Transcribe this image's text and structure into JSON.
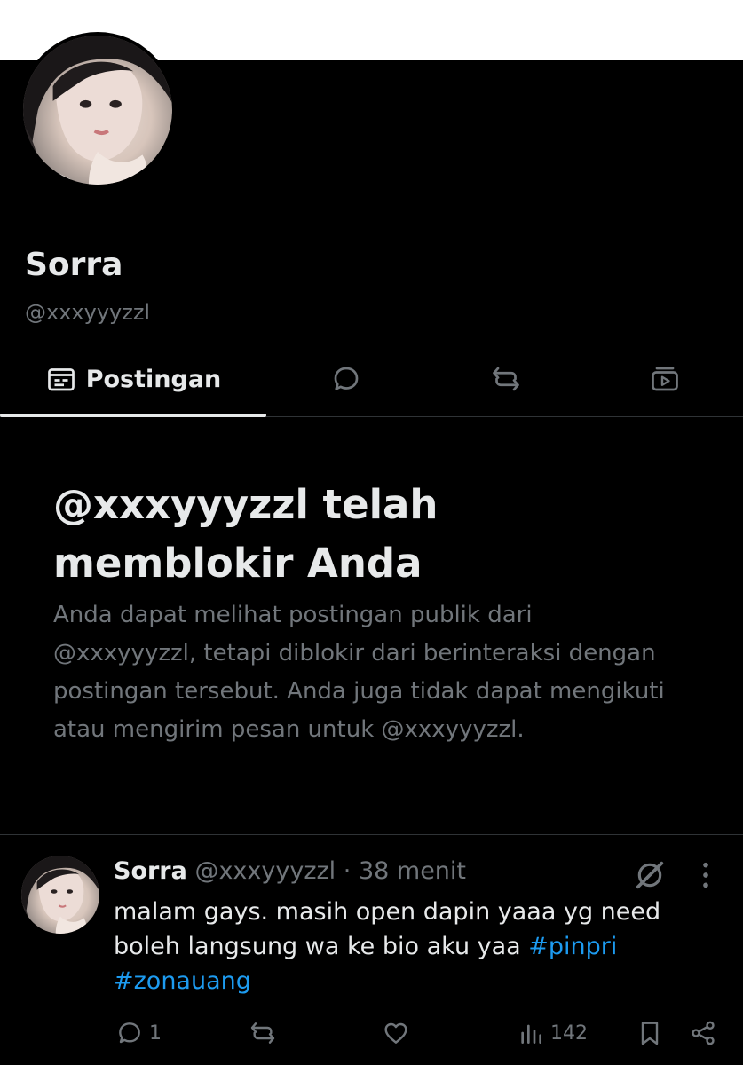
{
  "profile": {
    "display_name": "Sorra",
    "handle": "@xxxyyyzzl"
  },
  "tabs": [
    {
      "label": "Postingan",
      "icon": "posts-icon",
      "active": true
    },
    {
      "label": "",
      "icon": "replies-icon",
      "active": false
    },
    {
      "label": "",
      "icon": "reposts-icon",
      "active": false
    },
    {
      "label": "",
      "icon": "media-icon",
      "active": false
    }
  ],
  "blocked_notice": {
    "title": "@xxxyyyzzl telah memblokir Anda",
    "description": "Anda dapat melihat postingan publik dari @xxxyyyzzl, tetapi diblokir dari berinteraksi dengan postingan tersebut. Anda juga tidak dapat mengikuti atau mengirim pesan untuk @xxxyyyzzl."
  },
  "post": {
    "author_name": "Sorra",
    "author_handle": "@xxxyyyzzl",
    "separator": "·",
    "time": "38 menit",
    "text": "malam gays.  masih open dapin yaaa yg need boleh langsung wa ke bio aku yaa ",
    "hashtags": [
      "#pinpri",
      "#zonauang"
    ],
    "reply_count": "1",
    "repost_count": "",
    "like_count": "",
    "view_count": "142"
  },
  "colors": {
    "background": "#000000",
    "text_primary": "#e7e9ea",
    "text_secondary": "#71767b",
    "hashtag": "#1d9bf0",
    "divider": "#2f3336"
  }
}
